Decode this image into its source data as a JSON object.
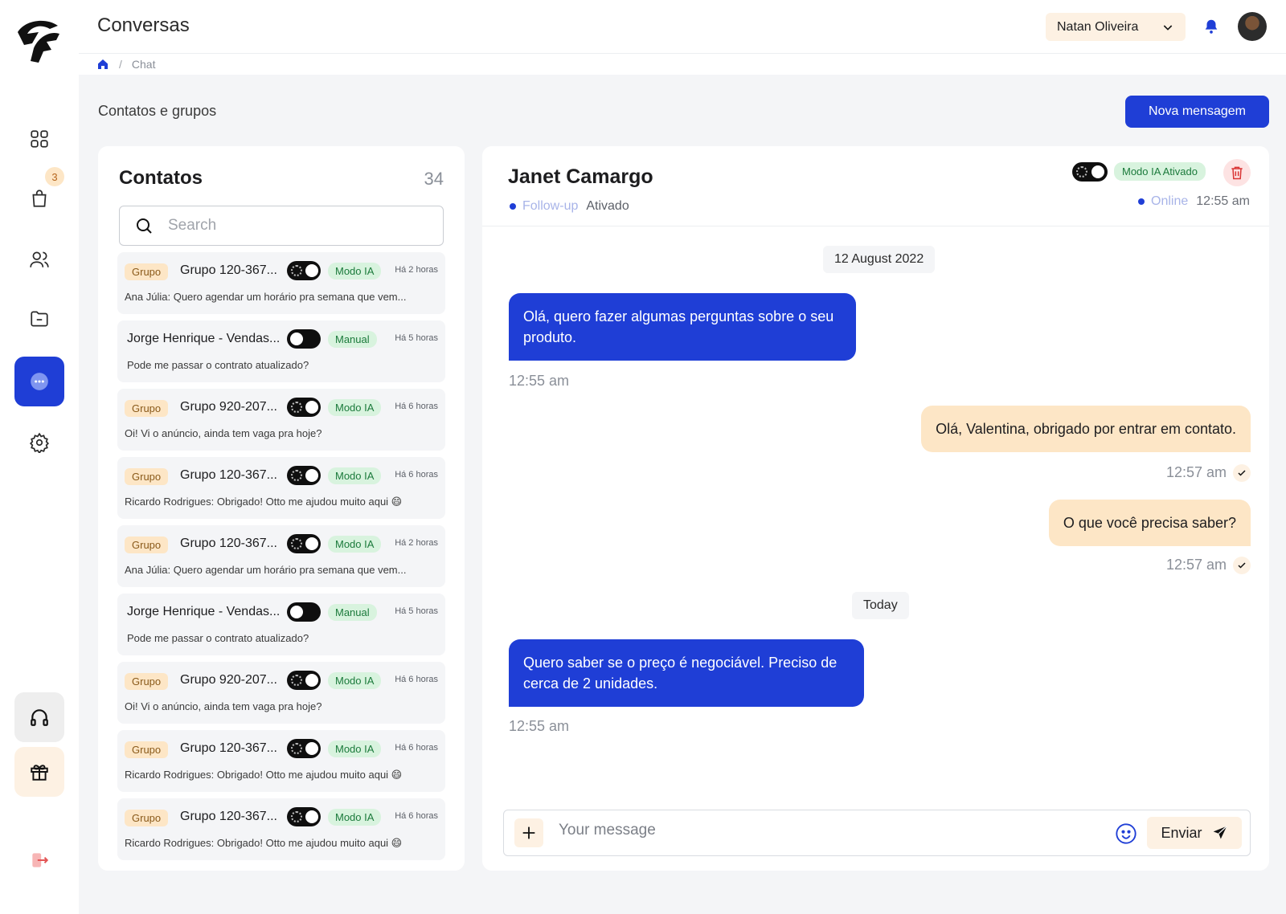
{
  "header": {
    "title": "Conversas",
    "user_name": "Natan Oliveira"
  },
  "breadcrumb": {
    "current": "Chat",
    "separator": "/"
  },
  "sidebar": {
    "cart_badge": "3",
    "accent": "#1f3ed6"
  },
  "section": {
    "title": "Contatos e grupos",
    "new_message_label": "Nova mensagem"
  },
  "contacts": {
    "title": "Contatos",
    "count": "34",
    "search_placeholder": "Search",
    "items": [
      {
        "tag": "Grupo",
        "name": "Grupo 120-367...",
        "mode": "Modo IA",
        "time": "Há 2 horas",
        "preview": "Ana Júlia: Quero agendar um horário pra semana que vem..."
      },
      {
        "tag": "",
        "name": "Jorge Henrique - Vendas...",
        "mode": "Manual",
        "time": "Há 5 horas",
        "preview": "Pode me passar o contrato atualizado?"
      },
      {
        "tag": "Grupo",
        "name": "Grupo 920-207...",
        "mode": "Modo IA",
        "time": "Há 6 horas",
        "preview": "Oi! Vi o anúncio, ainda tem vaga pra hoje?"
      },
      {
        "tag": "Grupo",
        "name": "Grupo 120-367...",
        "mode": "Modo IA",
        "time": "Há 6 horas",
        "preview": "Ricardo Rodrigues: Obrigado! Otto me ajudou muito aqui 😄"
      },
      {
        "tag": "Grupo",
        "name": "Grupo 120-367...",
        "mode": "Modo IA",
        "time": "Há 2 horas",
        "preview": "Ana Júlia: Quero agendar um horário pra semana que vem..."
      },
      {
        "tag": "",
        "name": "Jorge Henrique - Vendas...",
        "mode": "Manual",
        "time": "Há 5 horas",
        "preview": "Pode me passar o contrato atualizado?"
      },
      {
        "tag": "Grupo",
        "name": "Grupo 920-207...",
        "mode": "Modo IA",
        "time": "Há 6 horas",
        "preview": "Oi! Vi o anúncio, ainda tem vaga pra hoje?"
      },
      {
        "tag": "Grupo",
        "name": "Grupo 120-367...",
        "mode": "Modo IA",
        "time": "Há 6 horas",
        "preview": "Ricardo Rodrigues: Obrigado! Otto me ajudou muito aqui 😄"
      },
      {
        "tag": "Grupo",
        "name": "Grupo 120-367...",
        "mode": "Modo IA",
        "time": "Há 6 horas",
        "preview": "Ricardo Rodrigues: Obrigado! Otto me ajudou muito aqui 😄"
      }
    ]
  },
  "chat": {
    "contact_name": "Janet Camargo",
    "followup_label": "Follow-up",
    "followup_value": "Ativado",
    "ia_status": "Modo IA Ativado",
    "online_label": "Online",
    "online_time": "12:55 am",
    "date_1": "12 August 2022",
    "date_2": "Today",
    "messages": [
      {
        "text": "Olá, quero fazer algumas perguntas sobre o seu produto.",
        "time": "12:55 am"
      },
      {
        "text": "Olá, Valentina, obrigado por entrar em contato.",
        "time": "12:57 am"
      },
      {
        "text": "O que você precisa saber?",
        "time": "12:57 am"
      },
      {
        "text": "Quero saber se o preço é negociável. Preciso de  cerca de 2 unidades.",
        "time": "12:55 am"
      }
    ],
    "input_placeholder": "Your message",
    "send_label": "Enviar"
  }
}
